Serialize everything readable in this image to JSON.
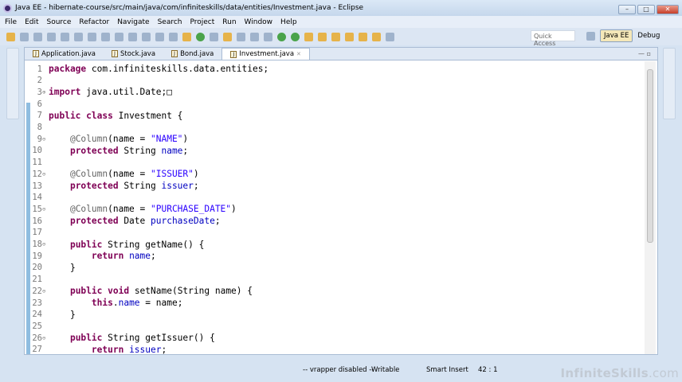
{
  "window": {
    "title": "Java EE - hibernate-course/src/main/java/com/infiniteskills/data/entities/Investment.java - Eclipse",
    "min": "–",
    "max": "□",
    "close": "✕"
  },
  "menu": [
    "File",
    "Edit",
    "Source",
    "Refactor",
    "Navigate",
    "Search",
    "Project",
    "Run",
    "Window",
    "Help"
  ],
  "toolbar": {
    "quick_access_placeholder": "Quick Access",
    "perspectives": [
      "Java EE",
      "Debug"
    ]
  },
  "tabs": [
    {
      "label": "Application.java",
      "active": false
    },
    {
      "label": "Stock.java",
      "active": false
    },
    {
      "label": "Bond.java",
      "active": false
    },
    {
      "label": "Investment.java",
      "active": true,
      "close": "✕"
    }
  ],
  "code": [
    {
      "n": "1",
      "t": [
        [
          "package",
          "kw"
        ],
        [
          " com.infiniteskills.data.entities;",
          ""
        ]
      ]
    },
    {
      "n": "2",
      "t": []
    },
    {
      "n": "3",
      "fold": "⊕",
      "t": [
        [
          "import",
          "kw"
        ],
        [
          " java.util.Date;",
          ""
        ],
        [
          "□",
          ""
        ]
      ]
    },
    {
      "n": "6",
      "t": []
    },
    {
      "n": "7",
      "t": [
        [
          "public",
          "kw"
        ],
        [
          " ",
          ""
        ],
        [
          "class",
          "kw"
        ],
        [
          " Investment {",
          ""
        ]
      ]
    },
    {
      "n": "8",
      "t": []
    },
    {
      "n": "9",
      "fold": "⊖",
      "t": [
        [
          "    ",
          ""
        ],
        [
          "@Column",
          "an"
        ],
        [
          "(name = ",
          ""
        ],
        [
          "\"NAME\"",
          "st"
        ],
        [
          ")",
          ""
        ]
      ]
    },
    {
      "n": "10",
      "t": [
        [
          "    ",
          ""
        ],
        [
          "protected",
          "kw"
        ],
        [
          " String ",
          ""
        ],
        [
          "name",
          "fd"
        ],
        [
          ";",
          ""
        ]
      ]
    },
    {
      "n": "11",
      "t": []
    },
    {
      "n": "12",
      "fold": "⊖",
      "t": [
        [
          "    ",
          ""
        ],
        [
          "@Column",
          "an"
        ],
        [
          "(name = ",
          ""
        ],
        [
          "\"ISSUER\"",
          "st"
        ],
        [
          ")",
          ""
        ]
      ]
    },
    {
      "n": "13",
      "t": [
        [
          "    ",
          ""
        ],
        [
          "protected",
          "kw"
        ],
        [
          " String ",
          ""
        ],
        [
          "issuer",
          "fd"
        ],
        [
          ";",
          ""
        ]
      ]
    },
    {
      "n": "14",
      "t": []
    },
    {
      "n": "15",
      "fold": "⊖",
      "t": [
        [
          "    ",
          ""
        ],
        [
          "@Column",
          "an"
        ],
        [
          "(name = ",
          ""
        ],
        [
          "\"PURCHASE_DATE\"",
          "st"
        ],
        [
          ")",
          ""
        ]
      ]
    },
    {
      "n": "16",
      "t": [
        [
          "    ",
          ""
        ],
        [
          "protected",
          "kw"
        ],
        [
          " Date ",
          ""
        ],
        [
          "purchaseDate",
          "fd"
        ],
        [
          ";",
          ""
        ]
      ]
    },
    {
      "n": "17",
      "t": []
    },
    {
      "n": "18",
      "fold": "⊖",
      "t": [
        [
          "    ",
          ""
        ],
        [
          "public",
          "kw"
        ],
        [
          " String getName() {",
          ""
        ]
      ]
    },
    {
      "n": "19",
      "t": [
        [
          "        ",
          ""
        ],
        [
          "return",
          "kw"
        ],
        [
          " ",
          ""
        ],
        [
          "name",
          "fd"
        ],
        [
          ";",
          ""
        ]
      ]
    },
    {
      "n": "20",
      "t": [
        [
          "    }",
          ""
        ]
      ]
    },
    {
      "n": "21",
      "t": []
    },
    {
      "n": "22",
      "fold": "⊖",
      "t": [
        [
          "    ",
          ""
        ],
        [
          "public",
          "kw"
        ],
        [
          " ",
          ""
        ],
        [
          "void",
          "kw"
        ],
        [
          " setName(String name) {",
          ""
        ]
      ]
    },
    {
      "n": "23",
      "t": [
        [
          "        ",
          ""
        ],
        [
          "this",
          "kw"
        ],
        [
          ".",
          ""
        ],
        [
          "name",
          "fd"
        ],
        [
          " = name;",
          ""
        ]
      ]
    },
    {
      "n": "24",
      "t": [
        [
          "    }",
          ""
        ]
      ]
    },
    {
      "n": "25",
      "t": []
    },
    {
      "n": "26",
      "fold": "⊖",
      "t": [
        [
          "    ",
          ""
        ],
        [
          "public",
          "kw"
        ],
        [
          " String getIssuer() {",
          ""
        ]
      ]
    },
    {
      "n": "27",
      "t": [
        [
          "        ",
          ""
        ],
        [
          "return",
          "kw"
        ],
        [
          " ",
          ""
        ],
        [
          "issuer",
          "fd"
        ],
        [
          ";",
          ""
        ]
      ]
    }
  ],
  "status": {
    "vrapper": "-- vrapper disabled --",
    "mode": "Writable",
    "insert": "Smart Insert",
    "position": "42 : 1"
  },
  "brand": {
    "name": "InfiniteSkills",
    ".com": ".com"
  }
}
